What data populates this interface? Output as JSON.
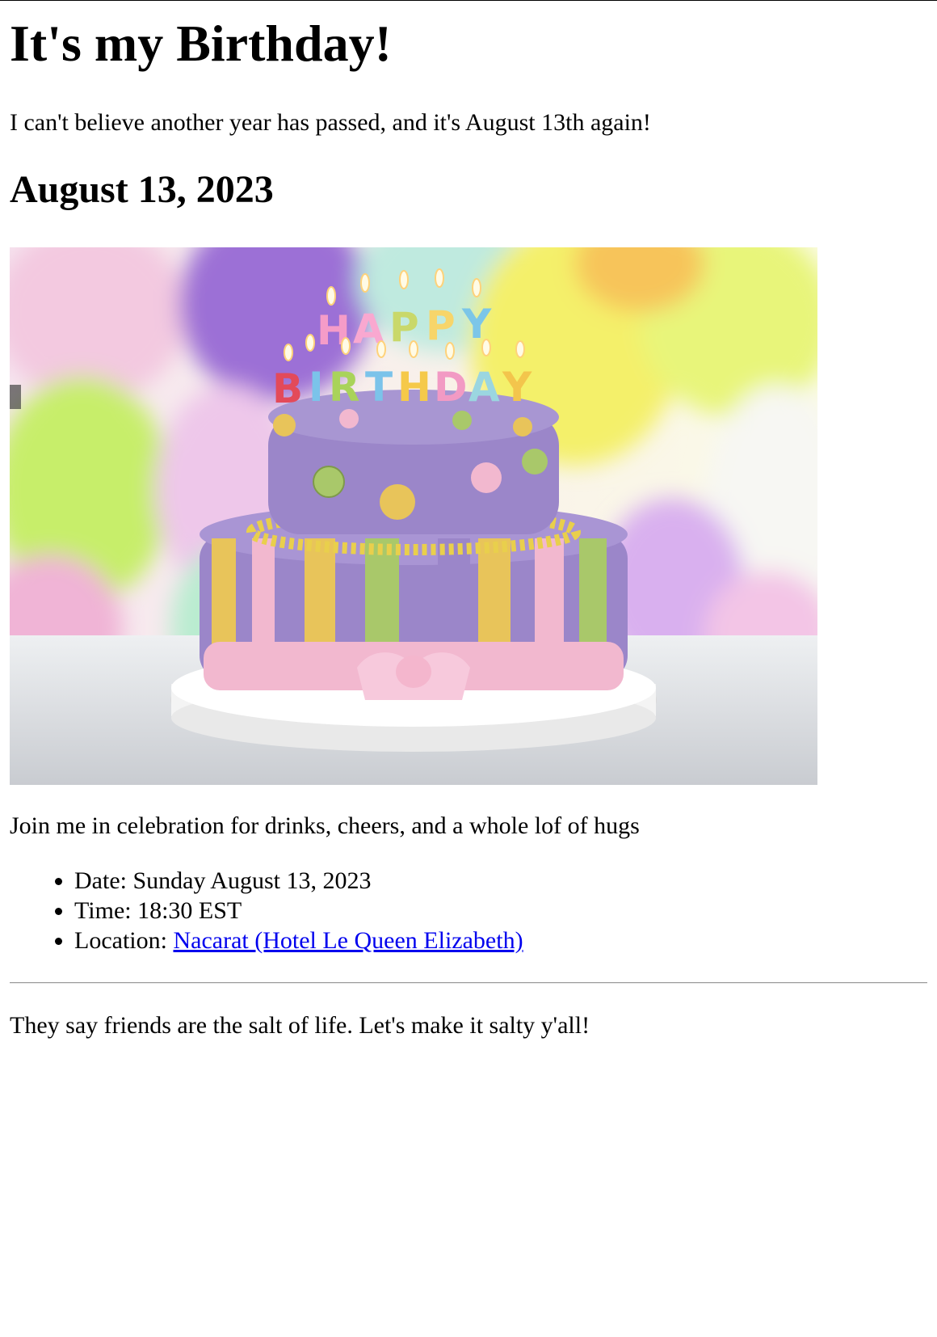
{
  "page": {
    "title": "It's my Birthday!",
    "intro": "I can't believe another year has passed, and it's August 13th again!",
    "date_heading": "August 13, 2023",
    "image": {
      "candle_letters_top": "HAPPY",
      "candle_letters_bottom": "BIRTHDAY"
    },
    "invite": "Join me in celebration for drinks, cheers, and a whole lof of hugs",
    "details": {
      "date": "Date: Sunday August 13, 2023",
      "time": "Time: 18:30 EST",
      "location_label": "Location: ",
      "location_link": "Nacarat (Hotel Le Queen Elizabeth)"
    },
    "closing": "They say friends are the salt of life. Let's make it salty y'all!"
  },
  "colors": {
    "link": "#0000EE",
    "cake_purple": "#9b86c9",
    "cake_pink": "#f2b8cf",
    "cake_yellow": "#e8c45a",
    "cake_green": "#a9c86a"
  }
}
